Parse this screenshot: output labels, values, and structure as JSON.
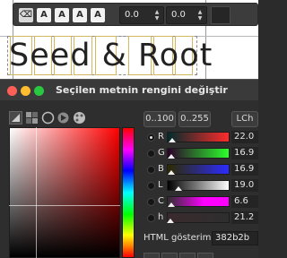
{
  "canvas": {
    "text": "Seed & Root"
  },
  "text_toolbar": {
    "style_buttons": [
      {
        "icon": "clear-formatting-icon",
        "glyph": "⌫"
      },
      {
        "icon": "text-style-a-icon",
        "glyph": "A"
      },
      {
        "icon": "text-style-a-icon",
        "glyph": "A"
      },
      {
        "icon": "text-style-a-icon",
        "glyph": "A"
      },
      {
        "icon": "text-style-a-icon",
        "glyph": "A"
      }
    ],
    "baseline_value": "0.0",
    "kerning_value": "0.0",
    "color": "#262626"
  },
  "dialog": {
    "title": "Seçilen metnin rengini değiştir",
    "traffic_lights": [
      "#ff5f57",
      "#febc2e",
      "#28c840"
    ],
    "mode_icons": [
      "triangle-picker-icon",
      "cmyk-icon",
      "watercolor-icon",
      "wheel-icon",
      "palette-icon"
    ],
    "range_buttons": [
      "0..100",
      "0..255"
    ],
    "lch_button": "LCh",
    "rows": [
      {
        "label": "R",
        "value": "22.0",
        "selected": true,
        "level": 0.086,
        "gradient": "linear-gradient(to right,#002b2b,#ff2b2b)"
      },
      {
        "label": "G",
        "value": "16.9",
        "selected": false,
        "level": 0.066,
        "gradient": "linear-gradient(to right,#2c002b,#2cff2b)"
      },
      {
        "label": "B",
        "value": "16.9",
        "selected": false,
        "level": 0.066,
        "gradient": "linear-gradient(to right,#2c2b00,#2c2bff)"
      },
      {
        "label": "L",
        "value": "19.0",
        "selected": false,
        "level": 0.19,
        "gradient": "linear-gradient(to right,#000000,#ffffff)"
      },
      {
        "label": "C",
        "value": "6.6",
        "selected": false,
        "level": 0.066,
        "gradient": "linear-gradient(to right,#2e2e2e,#ff00ff 60%,#ff00ff)"
      },
      {
        "label": "h",
        "value": "21.2",
        "selected": false,
        "level": 0.06,
        "gradient": "linear-gradient(to right,#3a2a2e,#2e2e2e)"
      }
    ],
    "html_label": "HTML gösterimi:",
    "html_value": "382b2b"
  }
}
